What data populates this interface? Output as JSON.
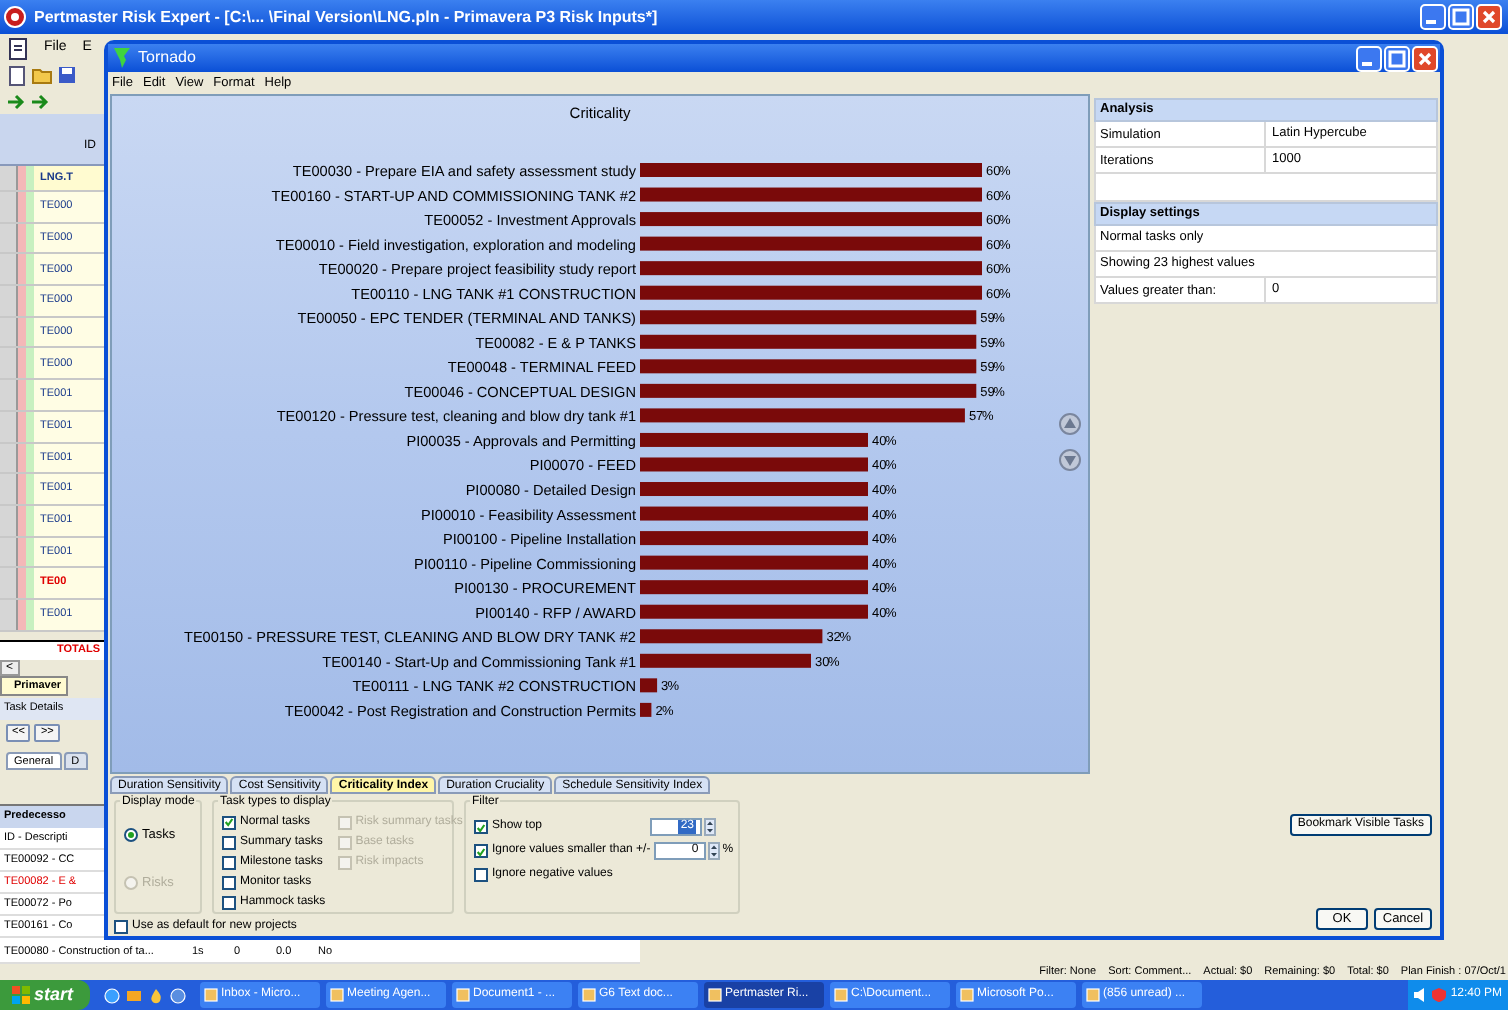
{
  "app": {
    "title": "Pertmaster Risk Expert - [C:\\... \\Final Version\\LNG.pln - Primavera P3 Risk Inputs*]",
    "menu": [
      "File",
      "E"
    ],
    "grid": {
      "header": "ID",
      "rows": [
        {
          "text": "LNG.T",
          "kind": "group",
          "red": false
        },
        {
          "text": "TE000",
          "kind": "task",
          "red": false
        },
        {
          "text": "TE000",
          "kind": "task",
          "red": false
        },
        {
          "text": "TE000",
          "kind": "task",
          "red": false
        },
        {
          "text": "TE000",
          "kind": "task",
          "red": false
        },
        {
          "text": "TE000",
          "kind": "task",
          "red": false
        },
        {
          "text": "TE000",
          "kind": "task",
          "red": false
        },
        {
          "text": "TE001",
          "kind": "task",
          "red": false
        },
        {
          "text": "TE001",
          "kind": "task",
          "red": false
        },
        {
          "text": "TE001",
          "kind": "task",
          "red": false
        },
        {
          "text": "TE001",
          "kind": "task",
          "red": false
        },
        {
          "text": "TE001",
          "kind": "task",
          "red": false
        },
        {
          "text": "TE001",
          "kind": "task",
          "red": false
        },
        {
          "text": "TE00",
          "kind": "task",
          "red": true
        },
        {
          "text": "TE001",
          "kind": "task",
          "red": false
        }
      ],
      "totals": "TOTALS",
      "scroll": "<",
      "sheet_tab": "Primaver"
    },
    "task_details": {
      "title": "Task Details",
      "nav": [
        "<<",
        ">>"
      ],
      "tabs": [
        {
          "label": "General",
          "selected": true
        },
        {
          "label": "D",
          "selected": false
        }
      ],
      "header": "Predecesso",
      "rows": [
        {
          "cells": [
            "ID - Descripti"
          ],
          "red": false
        },
        {
          "cells": [
            "TE00092 - CC"
          ],
          "red": false
        },
        {
          "cells": [
            "TE00082 - E &"
          ],
          "red": true
        },
        {
          "cells": [
            "TE00072 - Po"
          ],
          "red": false
        },
        {
          "cells": [
            "TE00161 - Co"
          ],
          "red": false
        },
        {
          "cells": [
            "TE00080 - Construction of ta...",
            "1s",
            "0",
            "0.0",
            "No"
          ],
          "red": false
        }
      ]
    },
    "status_bar": [
      "Filter: None",
      "Sort: Comment...",
      "Actual: $0",
      "Remaining: $0",
      "Total: $0",
      "Plan Finish : 07/Oct/1"
    ]
  },
  "tornado": {
    "title": "Tornado",
    "menu": [
      "File",
      "Edit",
      "View",
      "Format",
      "Help"
    ],
    "chart_data": {
      "type": "bar",
      "orientation": "horizontal",
      "title": "Criticality",
      "categories": [
        "TE00030 - Prepare EIA and safety assessment study",
        "TE00160 - START-UP AND COMMISSIONING TANK #2",
        "TE00052 - Investment Approvals",
        "TE00010 - Field investigation, exploration and modeling",
        "TE00020 - Prepare project feasibility study report",
        "TE00110 - LNG TANK #1 CONSTRUCTION",
        "TE00050 - EPC TENDER (TERMINAL AND TANKS)",
        "TE00082 - E & P TANKS",
        "TE00048 - TERMINAL FEED",
        "TE00046 - CONCEPTUAL DESIGN",
        "TE00120 - Pressure test, cleaning and blow dry tank #1",
        "PI00035 - Approvals and Permitting",
        "PI00070 - FEED",
        "PI00080 - Detailed Design",
        "PI00010 - Feasibility Assessment",
        "PI00100 - Pipeline Installation",
        "PI00110 - Pipeline Commissioning",
        "PI00130 - PROCUREMENT",
        "PI00140 - RFP / AWARD",
        "TE00150 - PRESSURE TEST, CLEANING AND BLOW DRY TANK #2",
        "TE00140 - Start-Up and Commissioning Tank #1",
        "TE00111 - LNG TANK #2 CONSTRUCTION",
        "TE00042 - Post Registration and Construction Permits"
      ],
      "series": [
        {
          "color": "#7a0a0a",
          "values": [
            60,
            60,
            60,
            60,
            60,
            60,
            59,
            59,
            59,
            59,
            57,
            40,
            40,
            40,
            40,
            40,
            40,
            40,
            40,
            32,
            30,
            3,
            2
          ]
        }
      ],
      "data_labels": true
    },
    "chart_value_unit": "%",
    "analysis": {
      "title": "Analysis",
      "rows": [
        {
          "label": "Simulation",
          "value": "Latin Hypercube"
        },
        {
          "label": "Iterations",
          "value": "1000"
        }
      ]
    },
    "display_settings": {
      "title": "Display settings",
      "rows": [
        {
          "label": "Normal tasks only"
        },
        {
          "label": "Showing 23 highest values"
        },
        {
          "label": "Values greater than:",
          "value": "0"
        }
      ]
    },
    "tabs": [
      {
        "label": "Duration Sensitivity",
        "selected": false
      },
      {
        "label": "Cost Sensitivity",
        "selected": false
      },
      {
        "label": "Criticality Index",
        "selected": true
      },
      {
        "label": "Duration Cruciality",
        "selected": false
      },
      {
        "label": "Schedule Sensitivity Index",
        "selected": false
      }
    ],
    "display_mode": {
      "title": "Display mode",
      "options": [
        {
          "label": "Tasks",
          "selected": true,
          "disabled": false
        },
        {
          "label": "Risks",
          "selected": false,
          "disabled": true
        }
      ]
    },
    "task_types": {
      "title": "Task types to display",
      "items": [
        {
          "label": "Normal tasks",
          "checked": true,
          "disabled": false
        },
        {
          "label": "Summary tasks",
          "checked": false,
          "disabled": false
        },
        {
          "label": "Milestone tasks",
          "checked": false,
          "disabled": false
        },
        {
          "label": "Monitor tasks",
          "checked": false,
          "disabled": false
        },
        {
          "label": "Hammock tasks",
          "checked": false,
          "disabled": false
        },
        {
          "label": "Risk summary tasks",
          "checked": false,
          "disabled": true
        },
        {
          "label": "Base tasks",
          "checked": false,
          "disabled": true
        },
        {
          "label": "Risk impacts",
          "checked": false,
          "disabled": true
        }
      ]
    },
    "filter": {
      "title": "Filter",
      "items": [
        {
          "label": "Show top",
          "checked": true,
          "value": "23"
        },
        {
          "label": "Ignore values smaller than +/-",
          "checked": true,
          "value": "0",
          "unit": "%"
        },
        {
          "label": "Ignore negative values",
          "checked": false
        }
      ]
    },
    "use_default": {
      "label": "Use as default for new projects",
      "checked": false
    },
    "buttons": {
      "bookmark": "Bookmark Visible Tasks",
      "ok": "OK",
      "cancel": "Cancel"
    }
  },
  "taskbar": {
    "start": "start",
    "items": [
      {
        "label": "Inbox - Micro...",
        "selected": false
      },
      {
        "label": "Meeting Agen...",
        "selected": false
      },
      {
        "label": "Document1 - ...",
        "selected": false
      },
      {
        "label": "G6 Text doc...",
        "selected": false
      },
      {
        "label": "Pertmaster Ri...",
        "selected": true
      },
      {
        "label": "C:\\Document...",
        "selected": false
      },
      {
        "label": "Microsoft Po...",
        "selected": false
      },
      {
        "label": "(856 unread) ...",
        "selected": false
      }
    ],
    "clock": "12:40 PM"
  }
}
